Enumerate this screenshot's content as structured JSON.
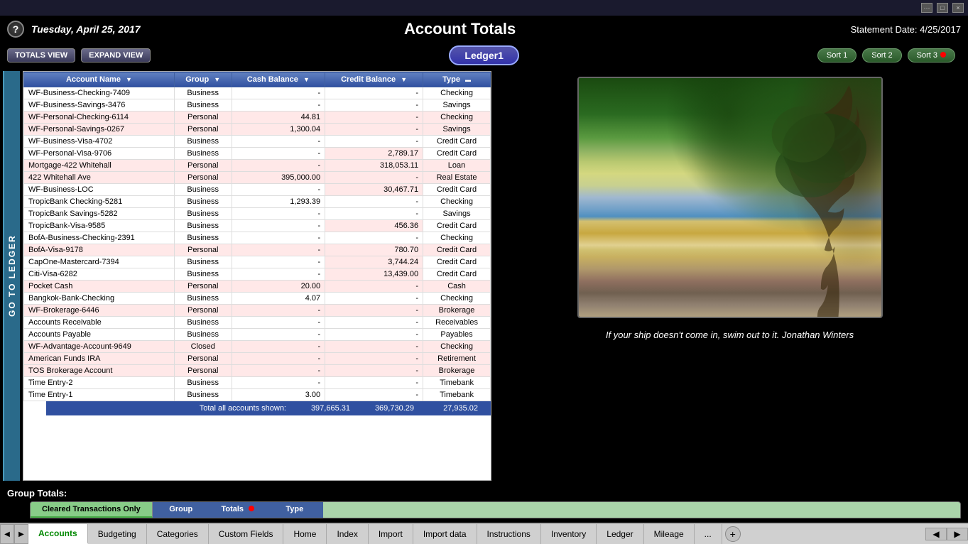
{
  "titlebar": {
    "buttons": [
      "...",
      "□",
      "×"
    ]
  },
  "header": {
    "help_btn": "?",
    "date": "Tuesday, April 25, 2017",
    "app_title": "Account Totals",
    "statement_label": "Statement Date:",
    "statement_date": "4/25/2017"
  },
  "toolbar": {
    "totals_view": "TOTALS VIEW",
    "expand_view": "EXPAND VIEW",
    "ledger_name": "Ledger1",
    "sort1": "Sort 1",
    "sort2": "Sort 2",
    "sort3": "Sort 3"
  },
  "go_to_ledger": "GO TO LEDGER",
  "table": {
    "columns": [
      {
        "label": "Account Name",
        "key": "name"
      },
      {
        "label": "Group",
        "key": "group"
      },
      {
        "label": "Cash Balance",
        "key": "cash"
      },
      {
        "label": "Credit Balance",
        "key": "credit"
      },
      {
        "label": "Type",
        "key": "type"
      }
    ],
    "rows": [
      {
        "name": "WF-Business-Checking-7409",
        "group": "Business",
        "cash": "-",
        "credit": "-",
        "type": "Checking"
      },
      {
        "name": "WF-Business-Savings-3476",
        "group": "Business",
        "cash": "-",
        "credit": "-",
        "type": "Savings"
      },
      {
        "name": "WF-Personal-Checking-6114",
        "group": "Personal",
        "cash": "44.81",
        "credit": "-",
        "type": "Checking"
      },
      {
        "name": "WF-Personal-Savings-0267",
        "group": "Personal",
        "cash": "1,300.04",
        "credit": "-",
        "type": "Savings"
      },
      {
        "name": "WF-Business-Visa-4702",
        "group": "Business",
        "cash": "-",
        "credit": "-",
        "type": "Credit Card"
      },
      {
        "name": "WF-Personal-Visa-9706",
        "group": "Business",
        "cash": "-",
        "credit": "2,789.17",
        "type": "Credit Card"
      },
      {
        "name": "Mortgage-422 Whitehall",
        "group": "Personal",
        "cash": "-",
        "credit": "318,053.11",
        "type": "Loan"
      },
      {
        "name": "422 Whitehall Ave",
        "group": "Personal",
        "cash": "395,000.00",
        "credit": "-",
        "type": "Real Estate"
      },
      {
        "name": "WF-Business-LOC",
        "group": "Business",
        "cash": "-",
        "credit": "30,467.71",
        "type": "Credit Card"
      },
      {
        "name": "TropicBank Checking-5281",
        "group": "Business",
        "cash": "1,293.39",
        "credit": "-",
        "type": "Checking"
      },
      {
        "name": "TropicBank Savings-5282",
        "group": "Business",
        "cash": "-",
        "credit": "-",
        "type": "Savings"
      },
      {
        "name": "TropicBank-Visa-9585",
        "group": "Business",
        "cash": "-",
        "credit": "456.36",
        "type": "Credit Card"
      },
      {
        "name": "BofA-Business-Checking-2391",
        "group": "Business",
        "cash": "-",
        "credit": "-",
        "type": "Checking"
      },
      {
        "name": "BofA-Visa-9178",
        "group": "Personal",
        "cash": "-",
        "credit": "780.70",
        "type": "Credit Card"
      },
      {
        "name": "CapOne-Mastercard-7394",
        "group": "Business",
        "cash": "-",
        "credit": "3,744.24",
        "type": "Credit Card"
      },
      {
        "name": "Citi-Visa-6282",
        "group": "Business",
        "cash": "-",
        "credit": "13,439.00",
        "type": "Credit Card"
      },
      {
        "name": "Pocket Cash",
        "group": "Personal",
        "cash": "20.00",
        "credit": "-",
        "type": "Cash"
      },
      {
        "name": "Bangkok-Bank-Checking",
        "group": "Business",
        "cash": "4.07",
        "credit": "-",
        "type": "Checking"
      },
      {
        "name": "WF-Brokerage-6446",
        "group": "Personal",
        "cash": "-",
        "credit": "-",
        "type": "Brokerage"
      },
      {
        "name": "Accounts Receivable",
        "group": "Business",
        "cash": "-",
        "credit": "-",
        "type": "Receivables"
      },
      {
        "name": "Accounts Payable",
        "group": "Business",
        "cash": "-",
        "credit": "-",
        "type": "Payables"
      },
      {
        "name": "WF-Advantage-Account-9649",
        "group": "Closed",
        "cash": "-",
        "credit": "-",
        "type": "Checking"
      },
      {
        "name": "American Funds IRA",
        "group": "Personal",
        "cash": "-",
        "credit": "-",
        "type": "Retirement"
      },
      {
        "name": "TOS Brokerage Account",
        "group": "Personal",
        "cash": "-",
        "credit": "-",
        "type": "Brokerage"
      },
      {
        "name": "Time Entry-2",
        "group": "Business",
        "cash": "-",
        "credit": "-",
        "type": "Timebank"
      },
      {
        "name": "Time Entry-1",
        "group": "Business",
        "cash": "3.00",
        "credit": "-",
        "type": "Timebank"
      }
    ],
    "totals": {
      "label": "Total all accounts shown:",
      "cash": "397,665.31",
      "credit": "369,730.29",
      "net": "27,935.02"
    }
  },
  "photo": {
    "alt": "Beach scene with tree"
  },
  "quote": "If your ship doesn't come in, swim out to it.  Jonathan Winters",
  "group_totals": {
    "label": "Group Totals:",
    "headers": [
      {
        "label": "Cleared Transactions Only",
        "active": true
      },
      {
        "label": "Group"
      },
      {
        "label": "Totals"
      },
      {
        "label": "Type"
      }
    ]
  },
  "tabs": {
    "items": [
      {
        "label": "Accounts",
        "active": true
      },
      {
        "label": "Budgeting",
        "active": false
      },
      {
        "label": "Categories",
        "active": false
      },
      {
        "label": "Custom Fields",
        "active": false
      },
      {
        "label": "Home",
        "active": false
      },
      {
        "label": "Index",
        "active": false
      },
      {
        "label": "Import",
        "active": false
      },
      {
        "label": "Import data",
        "active": false
      },
      {
        "label": "Instructions",
        "active": false
      },
      {
        "label": "Inventory",
        "active": false
      },
      {
        "label": "Ledger",
        "active": false
      },
      {
        "label": "Mileage",
        "active": false
      },
      {
        "label": "...",
        "active": false
      }
    ]
  }
}
